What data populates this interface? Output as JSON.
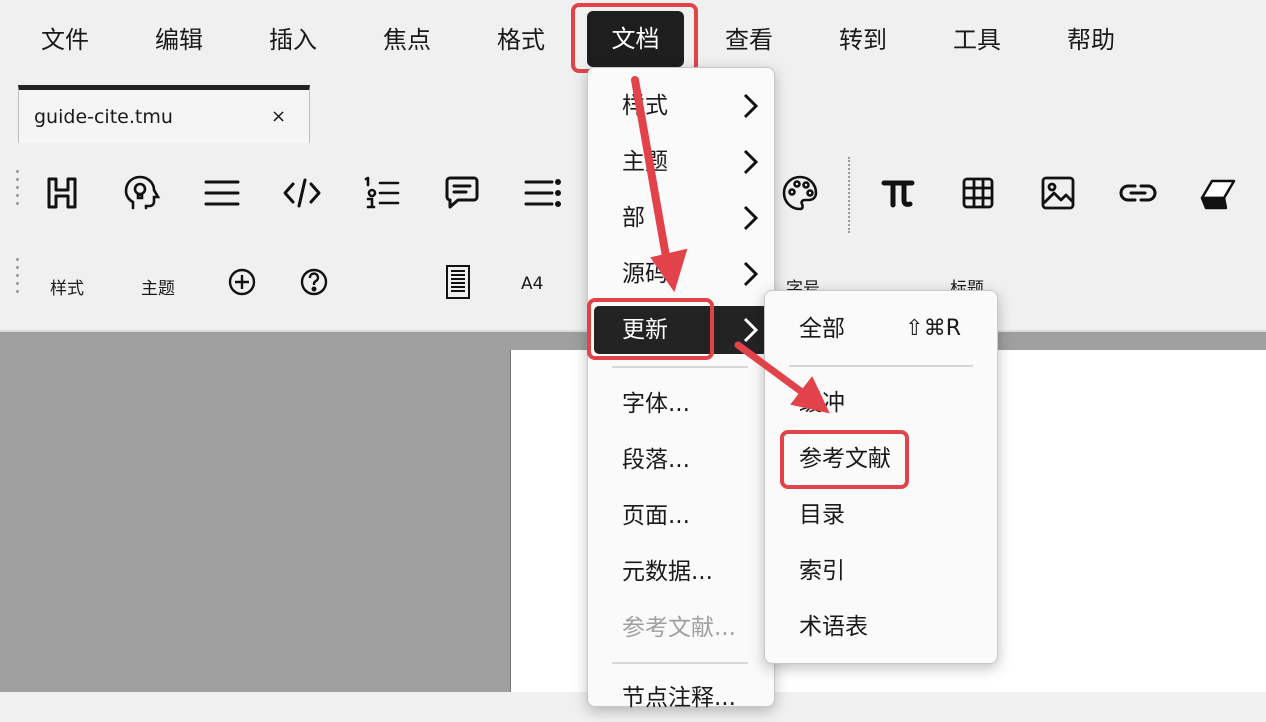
{
  "menubar": {
    "items": [
      "文件",
      "编辑",
      "插入",
      "焦点",
      "格式",
      "文档",
      "查看",
      "转到",
      "工具",
      "帮助"
    ],
    "active_index": 5
  },
  "tab": {
    "title": "guide-cite.tmu",
    "close": "×"
  },
  "toolbar1": {
    "icons": [
      "heading-icon",
      "brain-icon",
      "align-icon",
      "code-icon",
      "numbered-list-icon",
      "comment-icon",
      "list-icon",
      "palette-icon",
      "pi-icon",
      "table-icon",
      "image-icon",
      "link-icon",
      "eraser-icon"
    ]
  },
  "toolbar2": {
    "style_label": "样式",
    "theme_label": "主题",
    "page_size": "A4",
    "font_size_label": "字号",
    "heading_label": "标题"
  },
  "doc_menu": {
    "items": [
      {
        "label": "样式",
        "submenu": true
      },
      {
        "label": "主题",
        "submenu": true
      },
      {
        "label": "部",
        "submenu": true
      },
      {
        "label": "源码",
        "submenu": true
      },
      {
        "label": "更新",
        "submenu": true,
        "highlighted": true
      },
      {
        "label": "字体..."
      },
      {
        "label": "段落..."
      },
      {
        "label": "页面..."
      },
      {
        "label": "元数据..."
      },
      {
        "label": "参考文献...",
        "disabled": true
      },
      {
        "label": "节点注释..."
      }
    ]
  },
  "update_menu": {
    "items": [
      {
        "label": "全部",
        "shortcut": "⇧⌘R"
      },
      {
        "label": "缓冲"
      },
      {
        "label": "参考文献"
      },
      {
        "label": "目录"
      },
      {
        "label": "索引"
      },
      {
        "label": "术语表"
      }
    ]
  },
  "colors": {
    "highlight": "#e2434b",
    "menu_active": "#1e1e1e"
  }
}
